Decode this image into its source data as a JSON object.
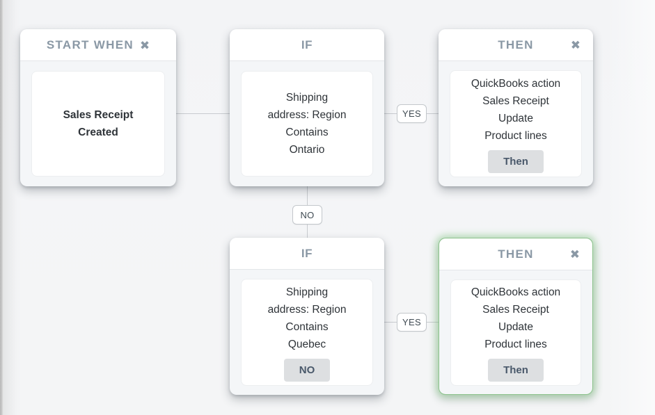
{
  "canvas": {
    "background_color": "#f4f5f7",
    "highlight_color": "#8cc28c",
    "connector_color": "#c8cbcf",
    "title_color": "#8a98a5"
  },
  "nodes": {
    "start_when": {
      "title": "START WHEN",
      "close_icon": "✖",
      "lines": [
        "Sales Receipt",
        "Created"
      ]
    },
    "if_top": {
      "title": "IF",
      "lines": [
        "Shipping",
        "address: Region",
        "Contains",
        "Ontario"
      ]
    },
    "then_top": {
      "title": "THEN",
      "close_icon": "✖",
      "lines": [
        "QuickBooks action",
        "Sales Receipt",
        "Update",
        "Product lines"
      ],
      "button_label": "Then"
    },
    "if_bottom": {
      "title": "IF",
      "lines": [
        "Shipping",
        "address: Region",
        "Contains",
        "Quebec"
      ],
      "button_label": "NO"
    },
    "then_bottom": {
      "title": "THEN",
      "close_icon": "✖",
      "lines": [
        "QuickBooks action",
        "Sales Receipt",
        "Update",
        "Product lines"
      ],
      "button_label": "Then",
      "highlighted": "true"
    }
  },
  "connectors": {
    "yes_top": "YES",
    "no_branch": "NO",
    "yes_bottom": "YES"
  }
}
